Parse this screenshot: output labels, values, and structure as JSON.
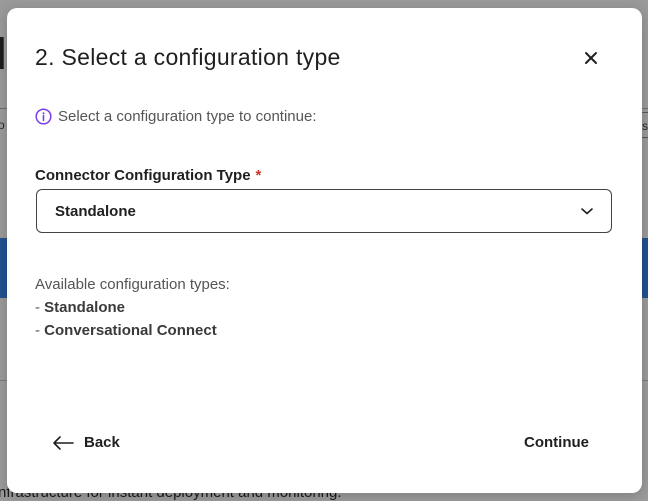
{
  "background": {
    "heading_fragment": "I",
    "left_fragment": "o",
    "right_fragment": "s",
    "footer_fragment": "nfrastructure for instant deployment and monitoring."
  },
  "modal": {
    "title": "2. Select a configuration type",
    "close_icon": "close-icon",
    "info_icon": "info-circle-icon",
    "info_text": "Select a configuration type to continue:",
    "field_label": "Connector Configuration Type",
    "required_mark": "*",
    "select": {
      "value": "Standalone",
      "icon": "chevron-down-icon"
    },
    "available_heading": "Available configuration types:",
    "available_types": [
      {
        "prefix": "- ",
        "name": "Standalone"
      },
      {
        "prefix": "- ",
        "name": "Conversational Connect"
      }
    ],
    "back_label": "Back",
    "continue_label": "Continue"
  },
  "colors": {
    "accent_purple": "#7b3fe4",
    "required_red": "#c8342b",
    "band_blue": "#23508f"
  }
}
